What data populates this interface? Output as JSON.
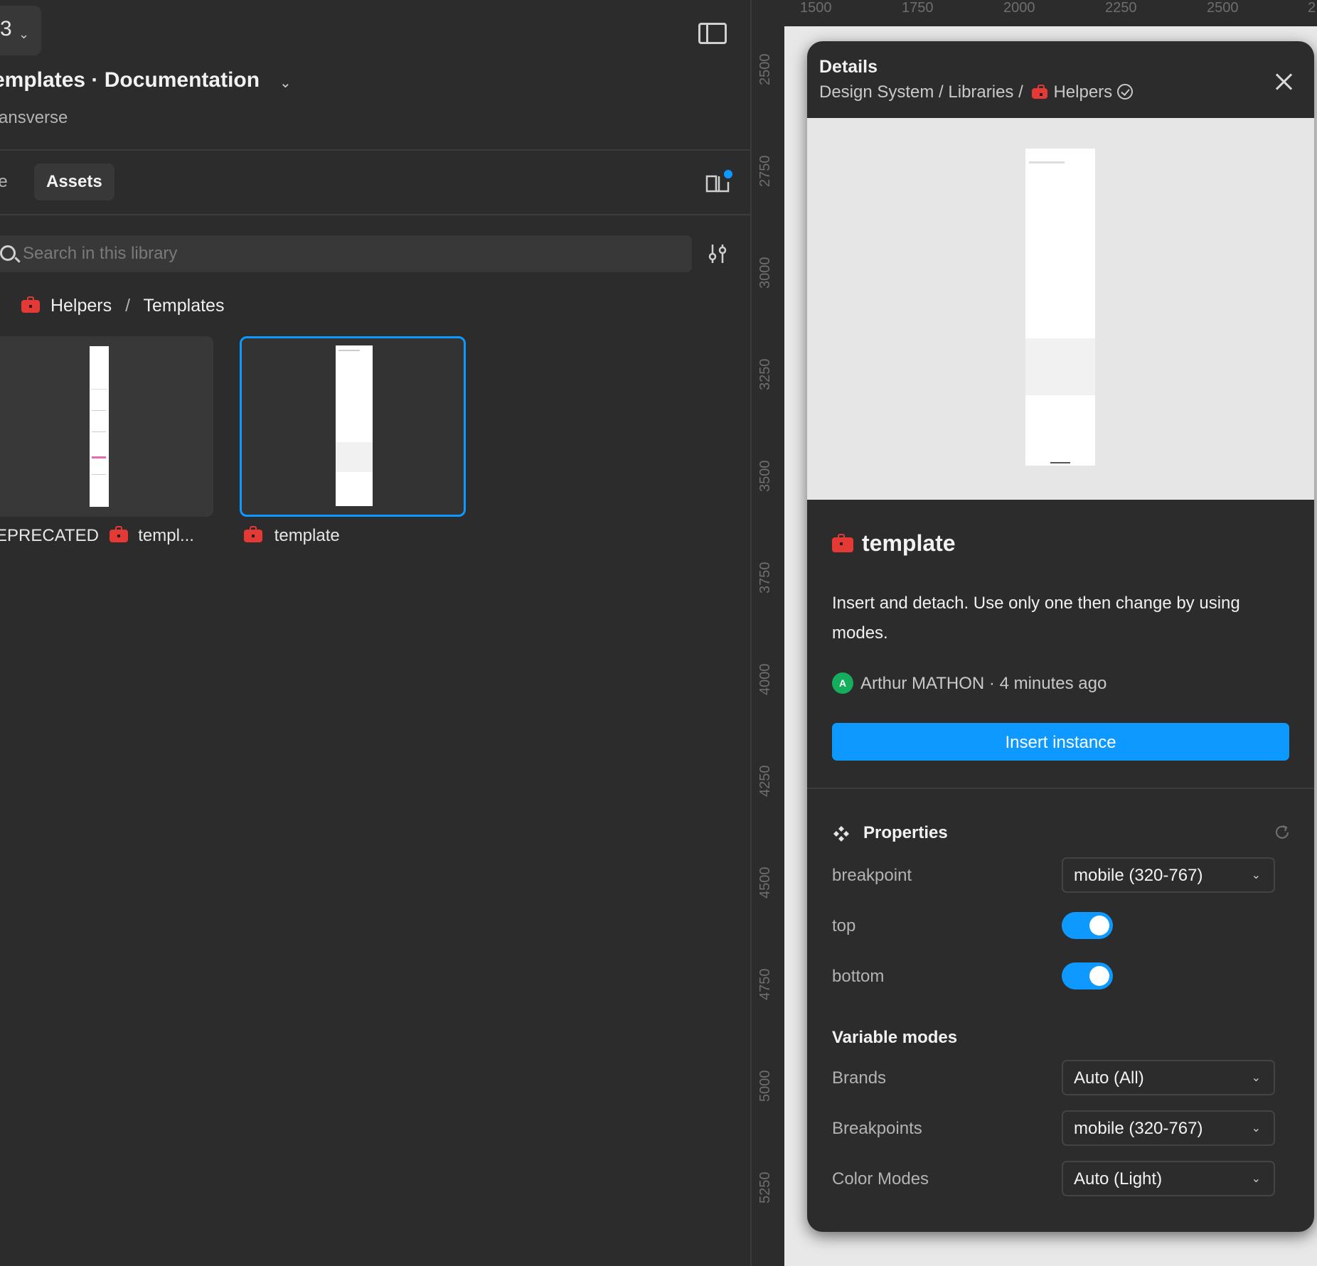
{
  "header": {
    "version_label": "3",
    "file_title": "emplates · Documentation",
    "team_name": "ransverse"
  },
  "tabs": {
    "file_partial": "le",
    "assets": "Assets"
  },
  "search": {
    "placeholder": "Search in this library"
  },
  "breadcrumb": {
    "parent": "Helpers",
    "separator": "/",
    "current": "Templates"
  },
  "assets": [
    {
      "prefix": "EPRECATED",
      "label": "templ..."
    },
    {
      "label": "template",
      "selected": true
    }
  ],
  "ruler": {
    "vertical": [
      "2500",
      "2750",
      "3000",
      "3250",
      "3500",
      "3750",
      "4000",
      "4250",
      "4500",
      "4750",
      "5000",
      "5250"
    ],
    "horizontal": [
      "1500",
      "1750",
      "2000",
      "2250",
      "2500",
      "2"
    ]
  },
  "details": {
    "title": "Details",
    "path_prefix": "Design System / Libraries /",
    "path_library": "Helpers",
    "component_name": "template",
    "description": "Insert and detach. Use only one then change by using modes.",
    "author_initial": "A",
    "author": "Arthur MATHON",
    "time": "· 4 minutes ago",
    "insert_button": "Insert instance",
    "properties_title": "Properties",
    "properties": {
      "breakpoint_label": "breakpoint",
      "breakpoint_value": "mobile (320-767)",
      "top_label": "top",
      "top_on": true,
      "bottom_label": "bottom",
      "bottom_on": true
    },
    "variable_modes_title": "Variable modes",
    "variable_modes": {
      "brands_label": "Brands",
      "brands_value": "Auto (All)",
      "breakpoints_label": "Breakpoints",
      "breakpoints_value": "mobile (320-767)",
      "color_modes_label": "Color Modes",
      "color_modes_value": "Auto (Light)"
    }
  },
  "colors": {
    "accent": "#0d99ff",
    "panel_bg": "#2c2c2c",
    "avatar": "#14ae5c"
  },
  "icons": [
    "chevron-down-icon",
    "panel-toggle-icon",
    "library-icon",
    "search-icon",
    "filter-icon",
    "toolbox-icon",
    "check-circle-icon",
    "close-icon",
    "properties-icon",
    "reset-icon"
  ]
}
